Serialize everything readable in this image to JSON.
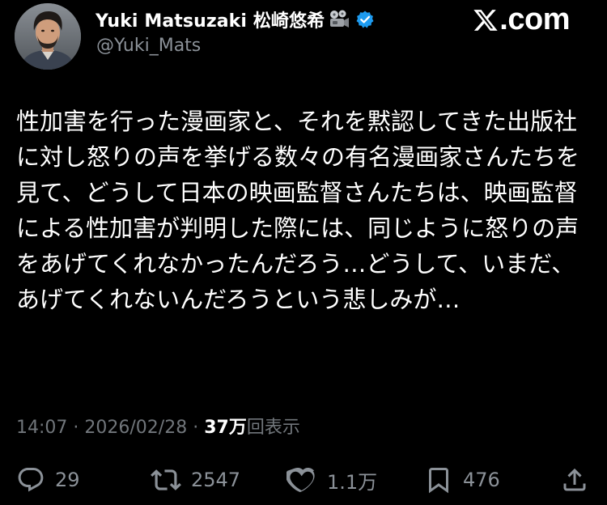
{
  "header": {
    "display_name": "Yuki Matsuzaki 松崎悠希",
    "emoji_icon": "film-projector-icon",
    "verified_icon": "verified-badge-icon",
    "verified_color": "#1d9bf0",
    "handle": "@Yuki_Mats",
    "brand": ".com",
    "brand_icon": "x-logo-icon"
  },
  "tweet": {
    "text": "性加害を行った漫画家と、それを黙認してきた出版社に対し怒りの声を挙げる数々の有名漫画家さんたちを見て、どうして日本の映画監督さんたちは、映画監督による性加害が判明した際には、同じように怒りの声をあげてくれなかったんだろう…どうして、いまだ、あげてくれないんだろうという悲しみが…"
  },
  "meta": {
    "time": "14:07",
    "separator": "·",
    "date": "2026/02/28",
    "views_count": "37万",
    "views_label": "回表示"
  },
  "actions": {
    "replies": "29",
    "reposts": "2547",
    "likes": "1.1万",
    "bookmarks": "476",
    "icons": [
      "reply-icon",
      "repost-icon",
      "like-icon",
      "bookmark-icon",
      "share-icon"
    ]
  },
  "colors": {
    "background": "#000000",
    "text": "#ffffff",
    "secondary": "#71767b"
  }
}
